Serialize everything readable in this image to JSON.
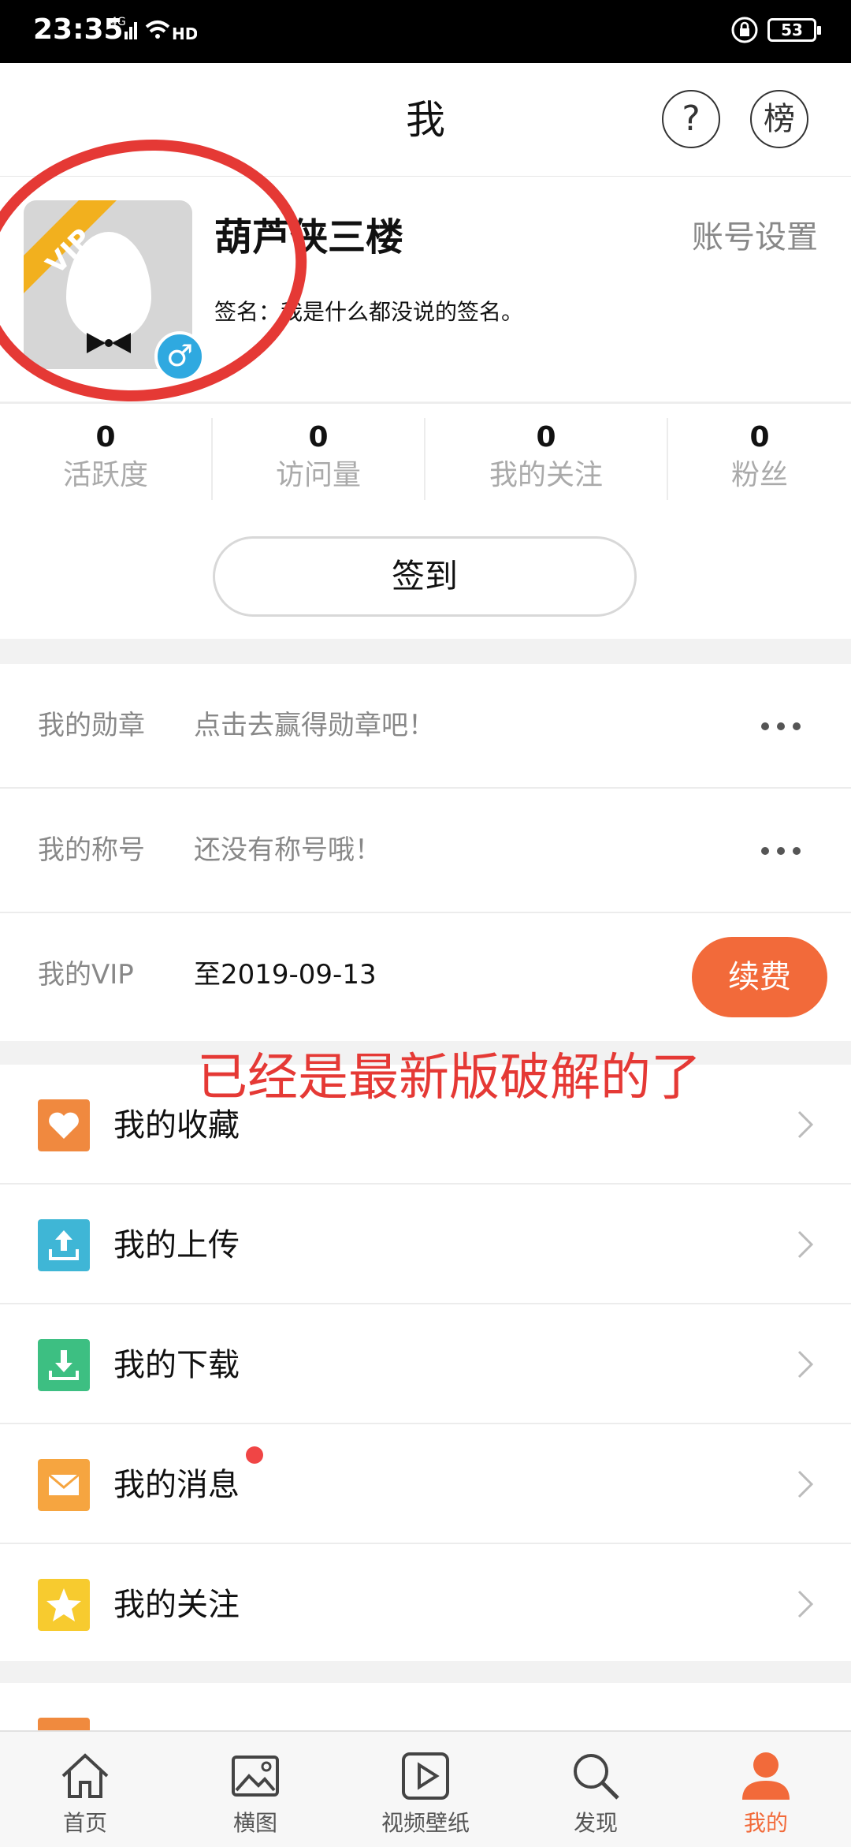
{
  "status_bar": {
    "time": "23:35",
    "signal": "4G HD",
    "battery": "53"
  },
  "header": {
    "title": "我",
    "help_label": "?",
    "rank_label": "榜"
  },
  "profile": {
    "vip_badge": "VIP",
    "gender_symbol": "♂",
    "username": "葫芦侠三楼",
    "signature": "签名：我是什么都没说的签名。",
    "account_settings": "账号设置"
  },
  "stats": [
    {
      "value": "0",
      "label": "活跃度"
    },
    {
      "value": "0",
      "label": "访问量"
    },
    {
      "value": "0",
      "label": "我的关注"
    },
    {
      "value": "0",
      "label": "粉丝"
    }
  ],
  "checkin": {
    "label": "签到"
  },
  "info": {
    "medal": {
      "label": "我的勋章",
      "value": "点击去赢得勋章吧！"
    },
    "title": {
      "label": "我的称号",
      "value": "还没有称号哦！"
    },
    "vip": {
      "label": "我的VIP",
      "value": "至2019-09-13",
      "renew": "续费"
    }
  },
  "annotation": "已经是最新版破解的了",
  "menu": [
    {
      "label": "我的收藏",
      "icon": "heart-icon",
      "color": "#f0893f"
    },
    {
      "label": "我的上传",
      "icon": "upload-icon",
      "color": "#3fb6d6"
    },
    {
      "label": "我的下载",
      "icon": "download-icon",
      "color": "#3dbf82"
    },
    {
      "label": "我的消息",
      "icon": "mail-icon",
      "color": "#f6a540"
    },
    {
      "label": "我的关注",
      "icon": "star-icon",
      "color": "#f7cb2f"
    }
  ],
  "partial_item": {
    "label": "",
    "color": "#f08a3e"
  },
  "tabs": [
    {
      "label": "首页",
      "icon": "home-icon"
    },
    {
      "label": "横图",
      "icon": "image-icon"
    },
    {
      "label": "视频壁纸",
      "icon": "video-icon"
    },
    {
      "label": "发现",
      "icon": "search-icon"
    },
    {
      "label": "我的",
      "icon": "user-icon",
      "active": true
    }
  ],
  "colors": {
    "accent": "#f26a3a",
    "annotation_red": "#e53935"
  }
}
